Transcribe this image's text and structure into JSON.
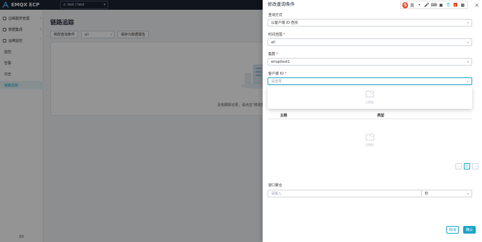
{
  "brand": {
    "name": "EMQX ECP"
  },
  "project_selector": {
    "value": "test / test"
  },
  "sidebar": {
    "items": [
      {
        "label": "边缘服务管理"
      },
      {
        "label": "数据集成"
      },
      {
        "label": "运维监控"
      }
    ],
    "sub_items": [
      {
        "label": "监控"
      },
      {
        "label": "告警"
      },
      {
        "label": "日志"
      },
      {
        "label": "链路追踪"
      }
    ],
    "footer": "EX"
  },
  "page": {
    "title": "链路追踪",
    "filter_button": "修改查询条件",
    "filter_value": "all",
    "save_button": "保存为数据报告",
    "empty_text": "没有跟踪记录，请点击“修改查"
  },
  "drawer": {
    "title": "修改查询条件",
    "fields": {
      "query_mode": {
        "label": "查询方式",
        "value": "以客户端 ID 查找"
      },
      "time_range": {
        "label": "时间范围",
        "value": "all"
      },
      "cluster": {
        "label": "集群",
        "value": "emqxtest1"
      },
      "client_id": {
        "label": "客户端 ID",
        "placeholder": "请选择"
      }
    },
    "dropdown_empty": "无数据",
    "table": {
      "headers": [
        "主题",
        "类型"
      ],
      "empty": "无数据"
    },
    "pager": {
      "current": "1"
    },
    "window": {
      "label": "窗口聚合",
      "placeholder": "请输入",
      "unit": "秒"
    },
    "buttons": {
      "cancel": "取消",
      "ok": "确认"
    }
  },
  "toolbar_icons": [
    "sogou-logo-icon",
    "ying-icon",
    "dot-icon",
    "mic-icon",
    "keyboard-icon",
    "image-icon",
    "shirt-icon",
    "gift-icon",
    "grid-icon"
  ],
  "colors": {
    "accent": "#1aa4c8",
    "topbar": "#1b2332",
    "sogou": "#e8482a"
  }
}
